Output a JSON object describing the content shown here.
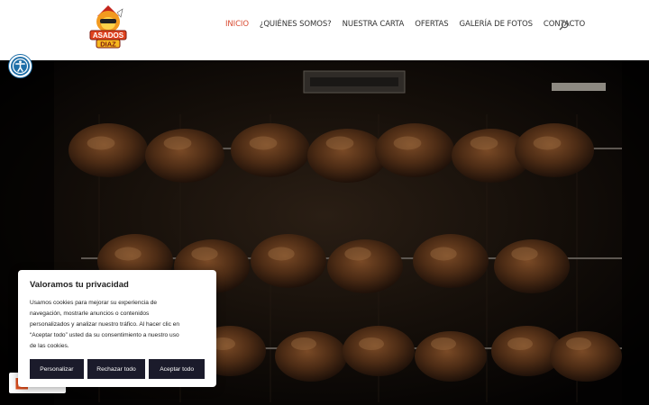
{
  "brand": {
    "logo_line1": "ASADOS",
    "logo_line2": "DIAZ"
  },
  "nav": {
    "items": [
      {
        "label": "INICIO",
        "active": true
      },
      {
        "label": "¿QUIÉNES SOMOS?"
      },
      {
        "label": "NUESTRA CARTA"
      },
      {
        "label": "OFERTAS"
      },
      {
        "label": "GALERÍA DE FOTOS"
      },
      {
        "label": "CONTACTO"
      }
    ],
    "search_icon": "search-icon"
  },
  "colors": {
    "accent": "#d84b31",
    "a11y": "#1f6fa8",
    "cookie_button": "#1b1b2b"
  },
  "accessibility": {
    "icon": "accessibility-icon"
  },
  "hero": {
    "description_icon": "rotisserie-photo"
  },
  "cookie_banner": {
    "title": "Valoramos tu privacidad",
    "lines": [
      "Usamos cookies para mejorar su experiencia de",
      "navegación, mostrarle anuncios o contenidos",
      "personalizados y analizar nuestro tráfico. Al hacer clic en",
      "“Aceptar todo” usted da su consentimiento a nuestro uso",
      "de las cookies."
    ],
    "buttons": {
      "customize": "Personalizar",
      "reject": "Rechazar todo",
      "accept": "Aceptar todo"
    }
  },
  "revisit": {
    "icon": "cookie-settings-icon"
  }
}
